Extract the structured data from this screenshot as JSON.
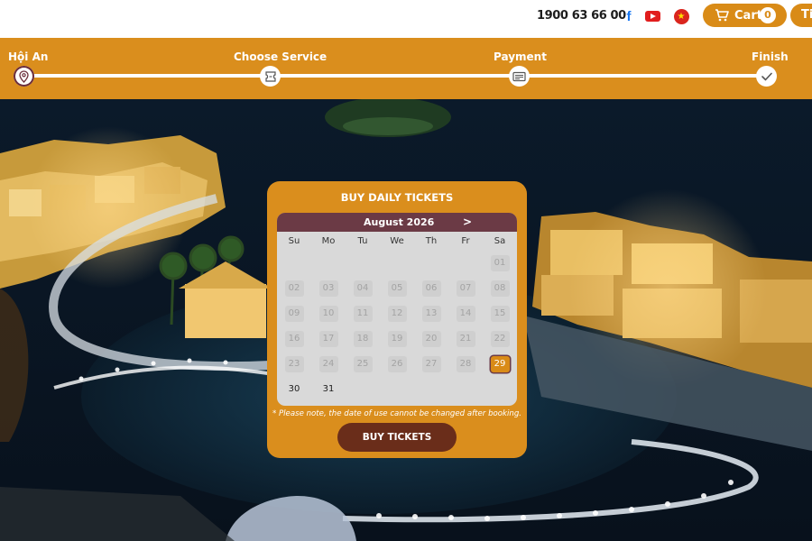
{
  "header": {
    "phone": "1900 63 66 00",
    "facebook_glyph": "f",
    "cart_label": "Cart",
    "cart_count": "0",
    "next_button_label": "Tic",
    "icons": [
      "facebook-icon",
      "youtube-icon",
      "vietnam-flag-icon",
      "cart-icon"
    ]
  },
  "stepper": {
    "steps": [
      {
        "label": "Hội An",
        "icon": "location-pin-icon"
      },
      {
        "label": "Choose Service",
        "icon": "ticket-icon"
      },
      {
        "label": "Payment",
        "icon": "payment-card-icon"
      },
      {
        "label": "Finish",
        "icon": "checkmark-icon"
      }
    ],
    "active_index": 0,
    "colors": {
      "bar": "#da8e1d",
      "active_ring": "#6b2d3a"
    }
  },
  "booking": {
    "title": "BUY DAILY TICKETS",
    "month_label": "August  2026",
    "next_month": ">",
    "weekdays": [
      "Su",
      "Mo",
      "Tu",
      "We",
      "Th",
      "Fr",
      "Sa"
    ],
    "first_weekday_index": 6,
    "days_in_month": 31,
    "disabled_through": 28,
    "selected_day": 29,
    "days": [
      "01",
      "02",
      "03",
      "04",
      "05",
      "06",
      "07",
      "08",
      "09",
      "10",
      "11",
      "12",
      "13",
      "14",
      "15",
      "16",
      "17",
      "18",
      "19",
      "20",
      "21",
      "22",
      "23",
      "24",
      "25",
      "26",
      "27",
      "28",
      "29",
      "30",
      "31"
    ],
    "note": "* Please note, the date of use cannot be changed after booking.",
    "buy_button": "BUY TICKETS",
    "colors": {
      "panel": "#da8e1d",
      "calendar_header": "#6b3a45",
      "button": "#6a2d1a",
      "selected": "#d98b17"
    }
  }
}
